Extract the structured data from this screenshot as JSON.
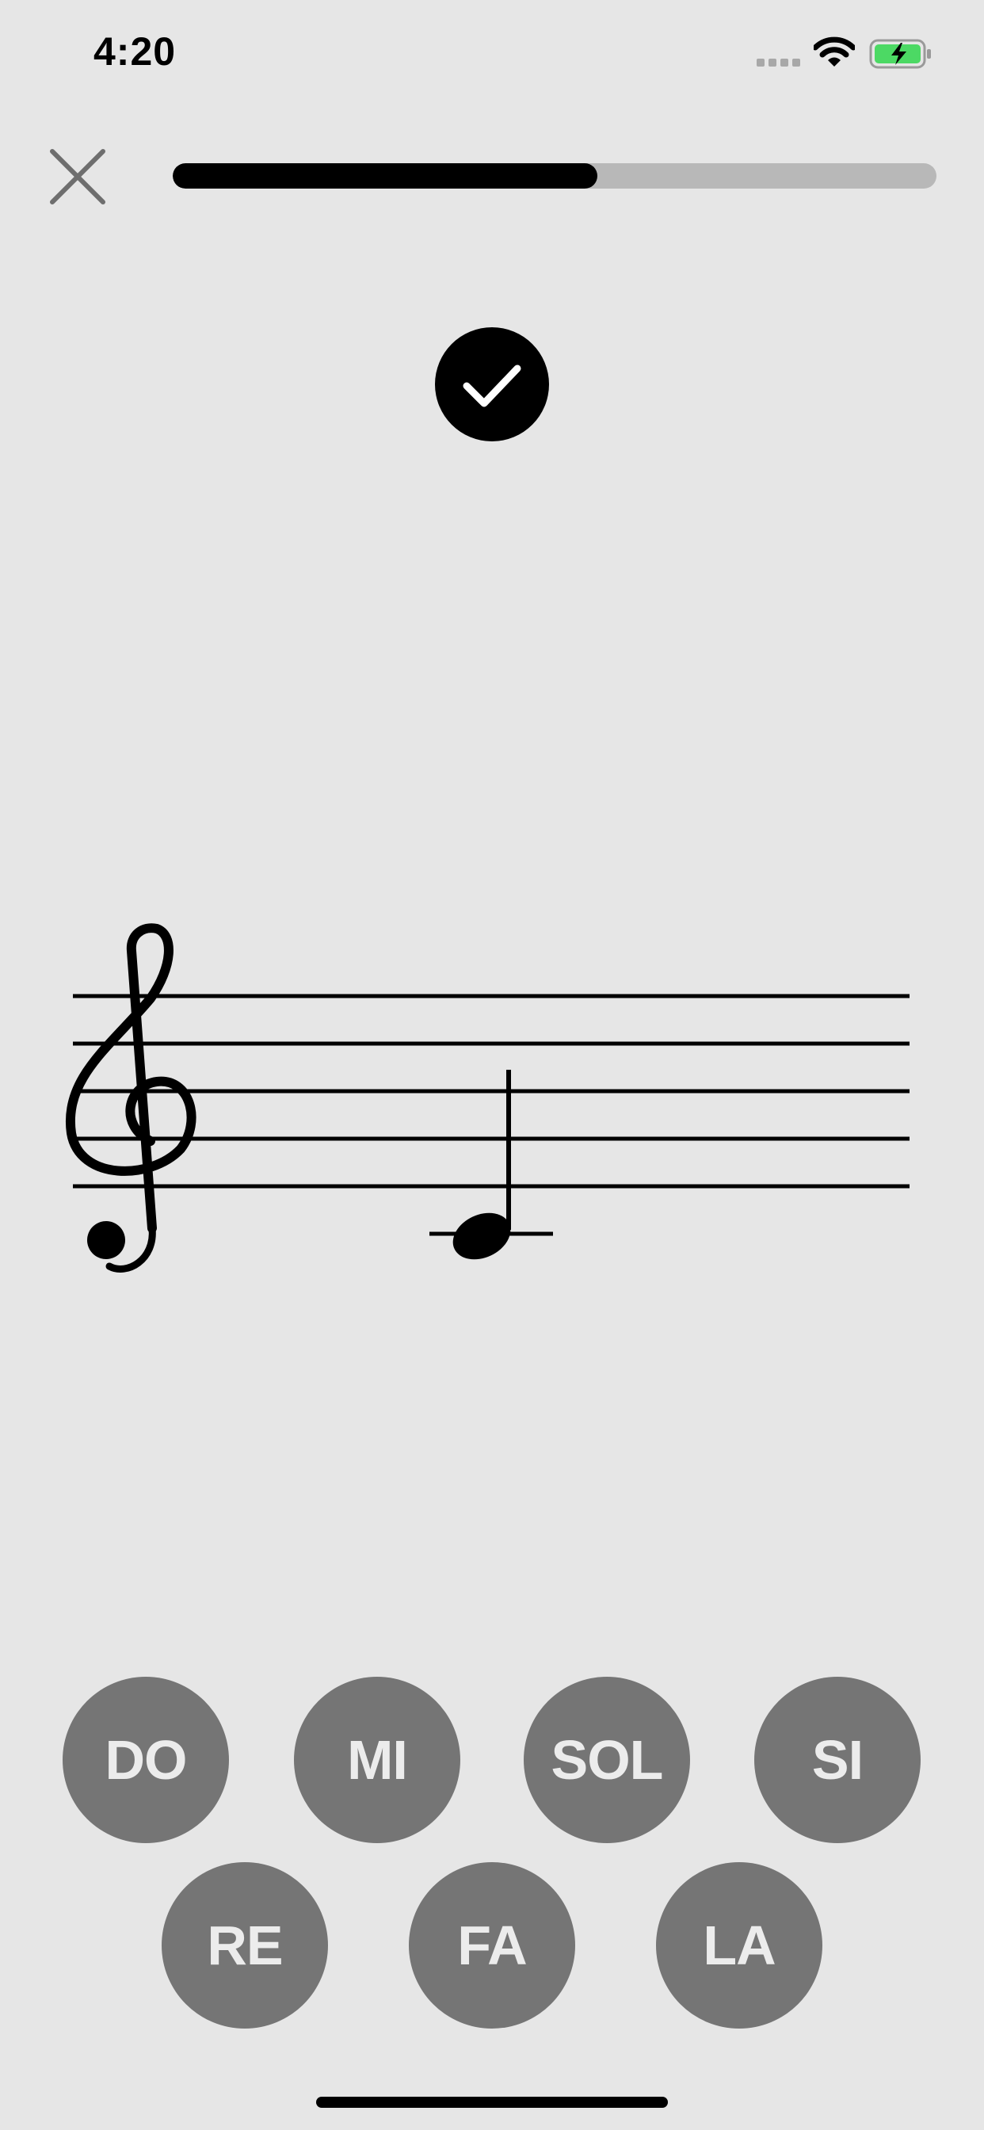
{
  "status_bar": {
    "time": "4:20"
  },
  "progress": {
    "fraction": 0.556
  },
  "answers_row1": [
    {
      "label": "DO"
    },
    {
      "label": "MI"
    },
    {
      "label": "SOL"
    },
    {
      "label": "SI"
    }
  ],
  "answers_row2": [
    {
      "label": "RE"
    },
    {
      "label": "FA"
    },
    {
      "label": "LA"
    }
  ],
  "icons": {
    "close": "close-icon",
    "check": "check-icon",
    "clef": "treble-clef-icon",
    "note": "quarter-note-icon"
  },
  "colors": {
    "background": "#e6e6e6",
    "button": "#757575",
    "button_text": "#ececec",
    "progress_fill": "#000000",
    "progress_track": "#b8b8b8",
    "battery_green": "#4cd964"
  }
}
